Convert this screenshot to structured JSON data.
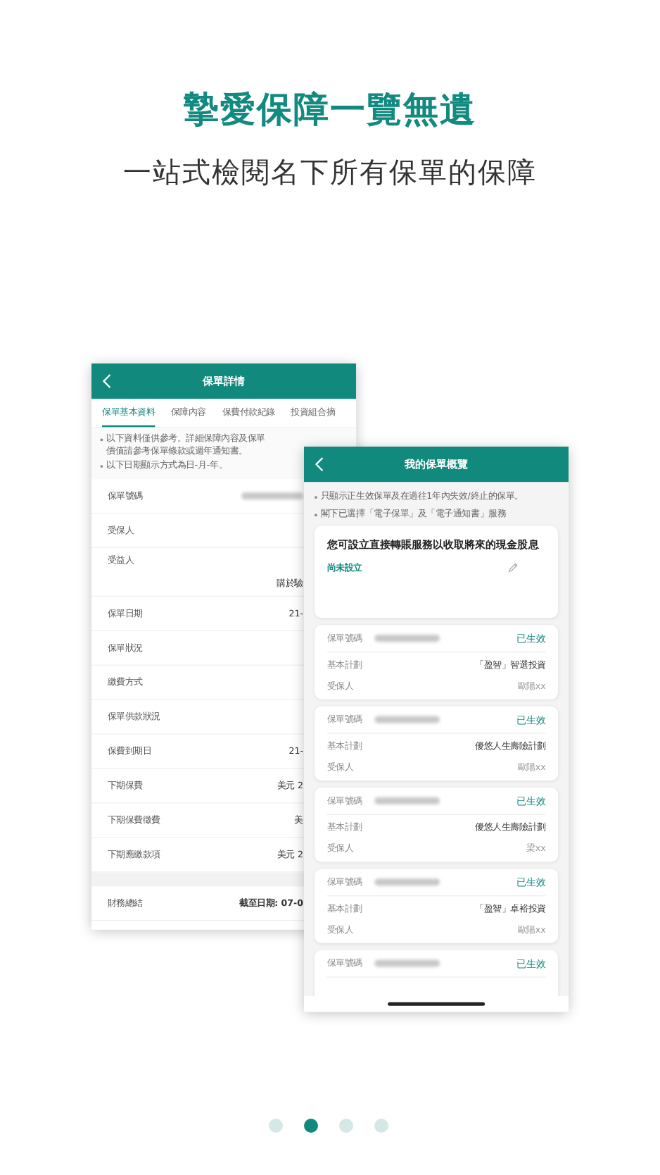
{
  "headline": "摯愛保障一覽無遺",
  "subheadline": "一站式檢閱名下所有保單的保障",
  "details_screen": {
    "title": "保單詳情",
    "tabs": [
      {
        "label": "保單基本資料",
        "selected": true
      },
      {
        "label": "保障內容",
        "selected": false
      },
      {
        "label": "保費付款紀錄",
        "selected": false
      },
      {
        "label": "投資組合摘",
        "selected": false
      }
    ],
    "notes": [
      "以下資料僅供參考。詳細保障內容及保單價值請參考保單條款或週年通知書。",
      "以下日期顯示方式為日-月-年。"
    ],
    "rows": [
      {
        "kind": "redacted",
        "label": "保單號碼"
      },
      {
        "kind": "text",
        "label": "受保人"
      },
      {
        "kind": "stacked",
        "label": "受益人",
        "value": "購於驗"
      },
      {
        "kind": "text",
        "label": "保單日期",
        "value": "21-"
      },
      {
        "kind": "text",
        "label": "保單狀況"
      },
      {
        "kind": "text",
        "label": "繳費方式"
      },
      {
        "kind": "text",
        "label": "保單供款狀況"
      },
      {
        "kind": "text",
        "label": "保費到期日",
        "value": "21-"
      },
      {
        "kind": "text",
        "label": "下期保費",
        "value": "美元 2"
      },
      {
        "kind": "text",
        "label": "下期保費徵費",
        "value": "美"
      },
      {
        "kind": "text",
        "label": "下期應繳款項",
        "value": "美元 2"
      }
    ],
    "summary": {
      "label": "財務總結",
      "value": "截至日期: 07-0"
    }
  },
  "overview_screen": {
    "title": "我的保單概覽",
    "notes": [
      "只顯示正生效保單及在過往1年內失效/終止的保單。",
      "閣下已選擇「電子保單」及「電子通知書」服務"
    ],
    "dividend_card": {
      "message": "您可設立直接轉賬服務以收取將來的現金股息",
      "status": "尚未設立"
    },
    "policies": [
      {
        "number_label": "保單號碼",
        "status": "已生效",
        "plan_label": "基本計劃",
        "plan": "「盈智」智選投資",
        "insured_label": "受保人",
        "insured": "歐陽xx"
      },
      {
        "number_label": "保單號碼",
        "status": "已生效",
        "plan_label": "基本計劃",
        "plan": "優悠人生壽險計劃",
        "insured_label": "受保人",
        "insured": "歐陽xx"
      },
      {
        "number_label": "保單號碼",
        "status": "已生效",
        "plan_label": "基本計劃",
        "plan": "優悠人生壽險計劃",
        "insured_label": "受保人",
        "insured": "梁xx"
      },
      {
        "number_label": "保單號碼",
        "status": "已生效",
        "plan_label": "基本計劃",
        "plan": "「盈智」卓裕投資",
        "insured_label": "受保人",
        "insured": "歐陽xx"
      },
      {
        "number_label": "保單號碼",
        "status": "已生效"
      }
    ]
  },
  "pager": [
    {
      "selected": false
    },
    {
      "selected": true
    },
    {
      "selected": false
    },
    {
      "selected": false
    }
  ]
}
